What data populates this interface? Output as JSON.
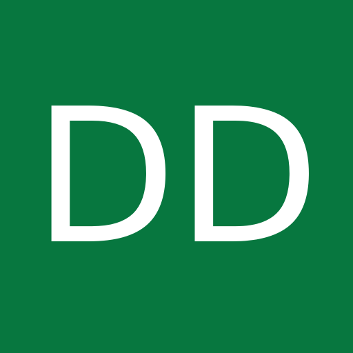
{
  "avatar": {
    "initials": "DD",
    "background_color": "#07773f",
    "text_color": "#ffffff"
  }
}
